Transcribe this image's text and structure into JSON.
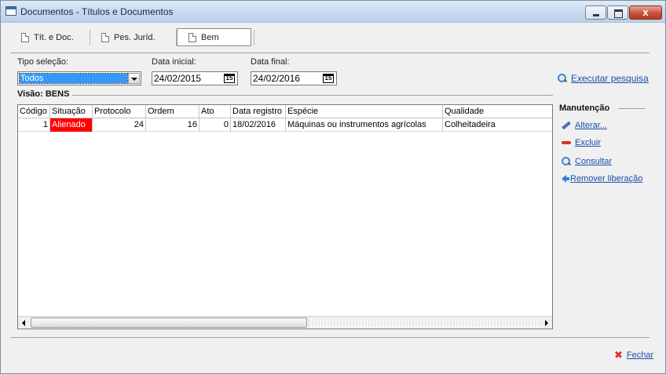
{
  "window": {
    "title": "Documentos - Títulos e Documentos",
    "close_glyph": "x"
  },
  "tabs": [
    {
      "label": "Tít. e Doc."
    },
    {
      "label": "Pes. Juríd."
    },
    {
      "label": "Bem",
      "active": true
    }
  ],
  "filters": {
    "tipo_label": "Tipo seleção:",
    "tipo_value": "Todos",
    "data_inicial_label": "Data inicial:",
    "data_inicial_value": "24/02/2015",
    "data_final_label": "Data final:",
    "data_final_value": "24/02/2016",
    "calendar_glyph": "15",
    "search_link": "Executar pesquisa"
  },
  "vision": {
    "title": "Visão: BENS"
  },
  "grid": {
    "columns": [
      "Código",
      "Situação",
      "Protocolo",
      "Ordem",
      "Ato",
      "Data registro",
      "Espécie",
      "Qualidade"
    ],
    "rows": [
      {
        "codigo": "1",
        "situacao": "Alienado",
        "protocolo": "24",
        "ordem": "16",
        "ato": "0",
        "data_registro": "18/02/2016",
        "especie": "Máquinas ou instrumentos agrícolas",
        "qualidade": "Colheitadeira"
      }
    ]
  },
  "manutencao": {
    "title": "Manutenção",
    "actions": [
      {
        "label": "Alterar...",
        "icon": "pencil-icon"
      },
      {
        "label": "Excluir",
        "icon": "minus-icon"
      },
      {
        "label": "Consultar",
        "icon": "magnifier-icon"
      },
      {
        "label": "Remover liberação",
        "icon": "back-arrow-icon"
      }
    ]
  },
  "footer": {
    "close_label": "Fechar",
    "close_glyph": "✖"
  },
  "colors": {
    "situation_alert": "#ff0000",
    "selection": "#3399ff",
    "link": "#1b4fa8"
  }
}
